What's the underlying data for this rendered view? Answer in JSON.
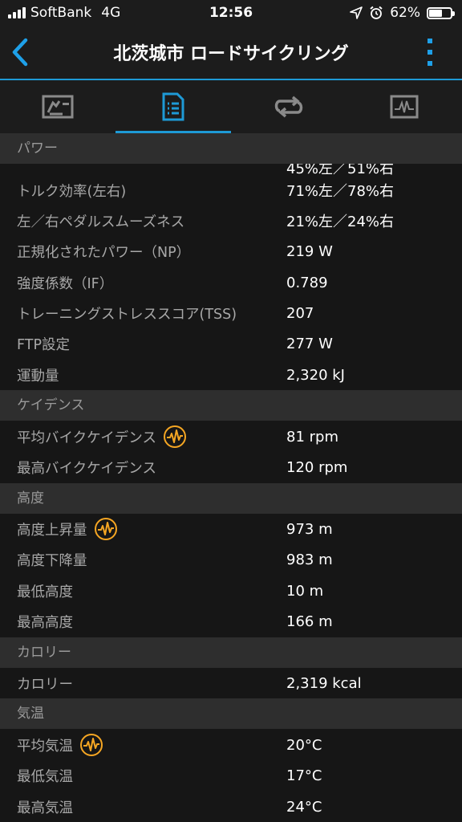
{
  "status_bar": {
    "carrier": "SoftBank",
    "network": "4G",
    "time": "12:56",
    "battery_text": "62%",
    "battery_level": 0.62
  },
  "nav": {
    "title": "北茨城市 ロードサイクリング"
  },
  "tabs": [
    {
      "icon": "stats-chart-icon",
      "active": false
    },
    {
      "icon": "document-list-icon",
      "active": true
    },
    {
      "icon": "loop-arrows-icon",
      "active": false
    },
    {
      "icon": "activity-graph-icon",
      "active": false
    }
  ],
  "sections": {
    "power": {
      "header": "パワー",
      "partial_value": "45%左／51%右",
      "rows": [
        {
          "label": "トルク効率(左右)",
          "value": "71%左／78%右"
        },
        {
          "label": "左／右ペダルスムーズネス",
          "value": "21%左／24%右"
        },
        {
          "label": "正規化されたパワー（NP）",
          "value": "219 W"
        },
        {
          "label": "強度係数（IF）",
          "value": "0.789"
        },
        {
          "label": "トレーニングストレススコア(TSS)",
          "value": "207"
        },
        {
          "label": "FTP設定",
          "value": "277 W"
        },
        {
          "label": "運動量",
          "value": "2,320 kJ"
        }
      ]
    },
    "cadence": {
      "header": "ケイデンス",
      "rows": [
        {
          "label": "平均バイクケイデンス",
          "value": "81 rpm",
          "has_chart_icon": true
        },
        {
          "label": "最高バイクケイデンス",
          "value": "120 rpm"
        }
      ]
    },
    "elevation": {
      "header": "高度",
      "rows": [
        {
          "label": "高度上昇量",
          "value": "973 m",
          "has_chart_icon": true
        },
        {
          "label": "高度下降量",
          "value": "983 m"
        },
        {
          "label": "最低高度",
          "value": "10 m"
        },
        {
          "label": "最高高度",
          "value": "166 m"
        }
      ]
    },
    "calories": {
      "header": "カロリー",
      "rows": [
        {
          "label": "カロリー",
          "value": "2,319 kcal"
        }
      ]
    },
    "temperature": {
      "header": "気温",
      "rows": [
        {
          "label": "平均気温",
          "value": "20°C",
          "has_chart_icon": true
        },
        {
          "label": "最低気温",
          "value": "17°C"
        },
        {
          "label": "最高気温",
          "value": "24°C"
        }
      ]
    }
  },
  "colors": {
    "accent_blue": "#1e9ad6",
    "chart_icon_orange": "#f5a623",
    "background": "#161616",
    "section_header_bg": "#2e2e2e"
  }
}
